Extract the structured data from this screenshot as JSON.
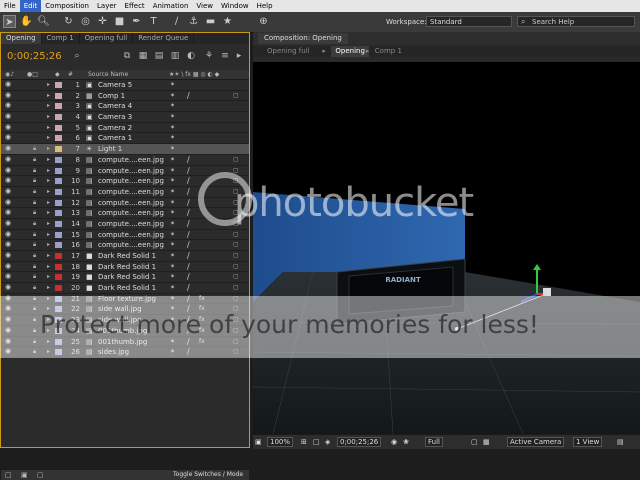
{
  "menu": [
    "File",
    "Edit",
    "Composition",
    "Layer",
    "Effect",
    "Animation",
    "View",
    "Window",
    "Help"
  ],
  "menu_active": "Edit",
  "toolbar": {
    "workspace_label": "Workspace:",
    "workspace_value": "Standard",
    "search_placeholder": "Search Help"
  },
  "timeline": {
    "tabs": [
      "Opening",
      "Comp 1",
      "Opening full",
      "Render Queue"
    ],
    "active_tab": "Opening",
    "timecode": "0;00;25;26",
    "column_source_name": "Source Name",
    "toggle_label": "Toggle Switches / Mode",
    "layers": [
      {
        "num": "1",
        "name": "Camera 5",
        "type": "camera",
        "color": "#c9a6b5"
      },
      {
        "num": "2",
        "name": "Comp 1",
        "type": "comp",
        "color": "#c9a6b5"
      },
      {
        "num": "3",
        "name": "Camera 4",
        "type": "camera",
        "color": "#c9a6b5"
      },
      {
        "num": "4",
        "name": "Camera 3",
        "type": "camera",
        "color": "#c9a6b5"
      },
      {
        "num": "5",
        "name": "Camera 2",
        "type": "camera",
        "color": "#c9a6b5"
      },
      {
        "num": "6",
        "name": "Camera 1",
        "type": "camera",
        "color": "#c9a6b5"
      },
      {
        "num": "7",
        "name": "Light 1",
        "type": "light",
        "color": "#d8c070",
        "selected": true
      },
      {
        "num": "8",
        "name": "compute....een.jpg",
        "type": "image",
        "color": "#9aa0cc"
      },
      {
        "num": "9",
        "name": "compute....een.jpg",
        "type": "image",
        "color": "#9aa0cc"
      },
      {
        "num": "10",
        "name": "compute....een.jpg",
        "type": "image",
        "color": "#9aa0cc"
      },
      {
        "num": "11",
        "name": "compute....een.jpg",
        "type": "image",
        "color": "#9aa0cc"
      },
      {
        "num": "12",
        "name": "compute....een.jpg",
        "type": "image",
        "color": "#9aa0cc"
      },
      {
        "num": "13",
        "name": "compute....een.jpg",
        "type": "image",
        "color": "#9aa0cc"
      },
      {
        "num": "14",
        "name": "compute....een.jpg",
        "type": "image",
        "color": "#9aa0cc"
      },
      {
        "num": "15",
        "name": "compute....een.jpg",
        "type": "image",
        "color": "#9aa0cc"
      },
      {
        "num": "16",
        "name": "compute....een.jpg",
        "type": "image",
        "color": "#9aa0cc"
      },
      {
        "num": "17",
        "name": "Dark Red Solid 1",
        "type": "solid",
        "color": "#c83030"
      },
      {
        "num": "18",
        "name": "Dark Red Solid 1",
        "type": "solid",
        "color": "#c83030"
      },
      {
        "num": "19",
        "name": "Dark Red Solid 1",
        "type": "solid",
        "color": "#c83030"
      },
      {
        "num": "20",
        "name": "Dark Red Solid 1",
        "type": "solid",
        "color": "#c83030"
      },
      {
        "num": "21",
        "name": "Floor texture.jpg",
        "type": "image",
        "color": "#9aa0cc"
      },
      {
        "num": "22",
        "name": "side wall.jpg",
        "type": "image",
        "color": "#9aa0cc"
      },
      {
        "num": "23",
        "name": "side wall.jpg",
        "type": "image",
        "color": "#9aa0cc"
      },
      {
        "num": "24",
        "name": "001thumb.jpg",
        "type": "image",
        "color": "#9aa0cc"
      },
      {
        "num": "25",
        "name": "001thumb.jpg",
        "type": "image",
        "color": "#9aa0cc"
      },
      {
        "num": "26",
        "name": "sides.jpg",
        "type": "image",
        "color": "#9aa0cc"
      }
    ]
  },
  "composition": {
    "tab": "Composition: Opening",
    "breadcrumbs": [
      "Opening full",
      "Opening",
      "Comp 1"
    ],
    "active_crumb": "Opening",
    "sign_text": "RADIANT",
    "zoom": "100%",
    "timecode": "0;00;25;26",
    "resolution": "Full",
    "camera": "Active Camera",
    "views": "1 View"
  },
  "watermark": {
    "logo": "photobucket",
    "promo": "Protect more of your memories for less!"
  },
  "colors": {
    "accent": "#e3a21a",
    "selection": "#3365c8",
    "wall": "#2b5fa8"
  }
}
